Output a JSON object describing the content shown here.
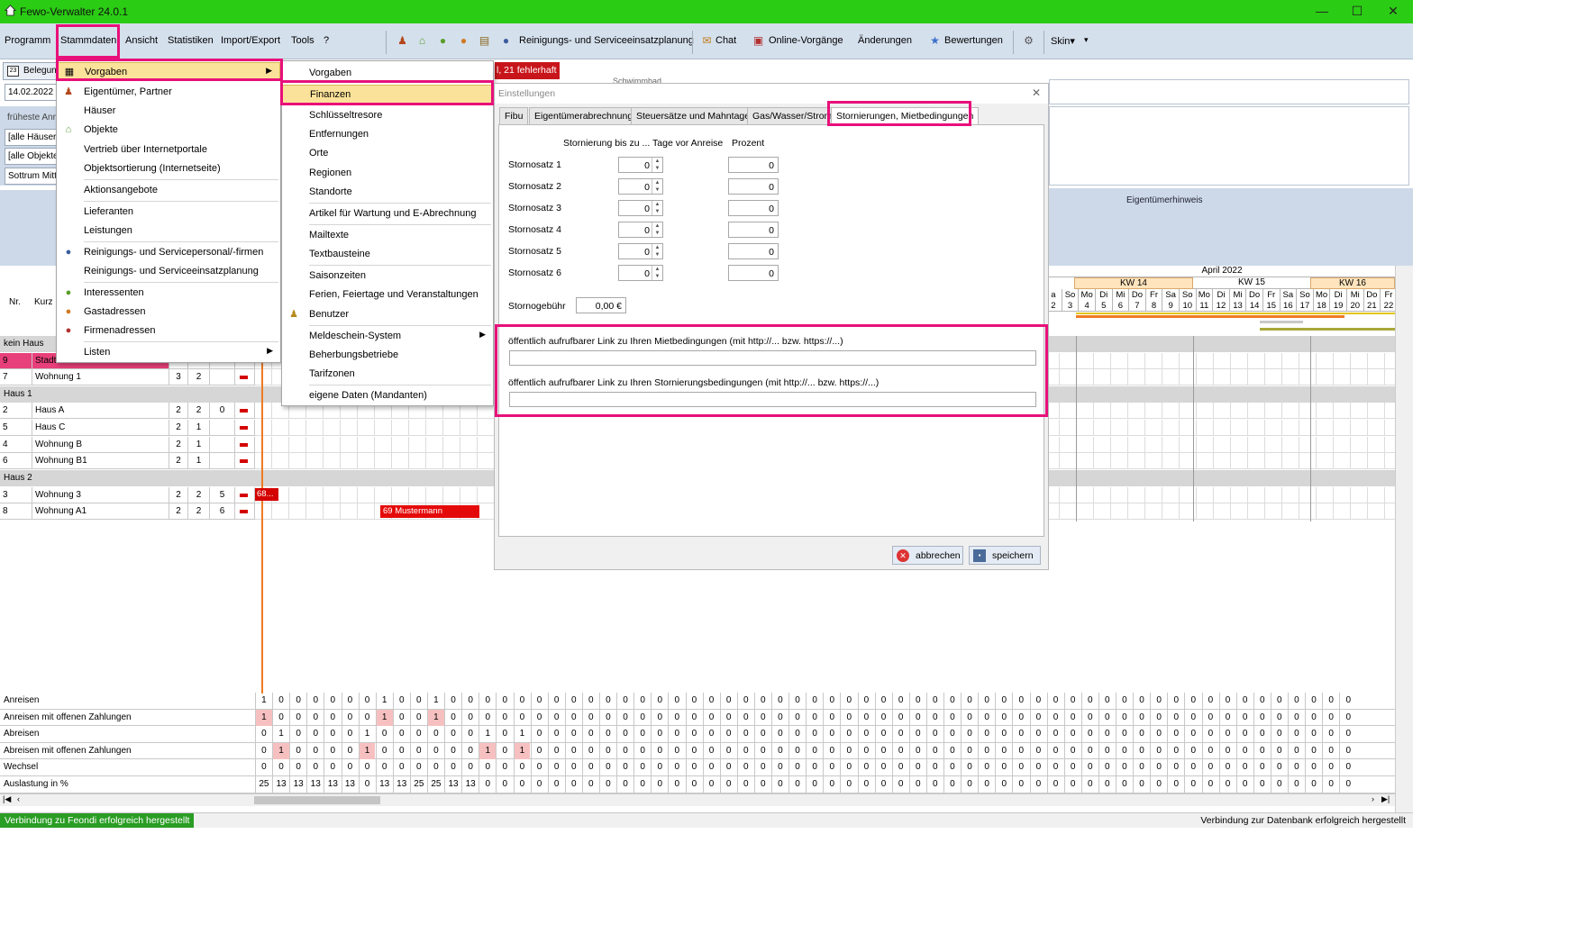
{
  "window": {
    "title": "Fewo-Verwalter 24.0.1",
    "minimize": "—",
    "maximize": "☐",
    "close": "✕"
  },
  "menubar": {
    "items": [
      "Programm",
      "Stammdaten",
      "Ansicht",
      "Statistiken",
      "Import/Export",
      "Tools",
      "?"
    ],
    "toolbar": {
      "cleaning_planning": "Reinigungs- und Serviceeinsatzplanung",
      "chat": "Chat",
      "online": "Online-Vorgänge",
      "changes": "Änderungen",
      "ratings": "Bewertungen",
      "skin": "Skin▾",
      "overflow": "▾"
    }
  },
  "left": {
    "tab_label": "Belegung",
    "date": "14.02.2022",
    "earliest_label": "früheste Anr",
    "houses": "[alle Häuser]",
    "objects": "[alle Objekte]",
    "location": "Sottrum Mitt",
    "col_nr": "Nr.",
    "col_kurz": "Kurz"
  },
  "alert": "l, 21 fehlerhaft",
  "top_text": "Schwimmbad",
  "owner_hint": "Eigentümerhinweis",
  "groups": {
    "kein_haus": "kein Haus",
    "haus1": "Haus 1",
    "haus2": "Haus 2"
  },
  "rows": [
    {
      "nr": "9",
      "name": "Stadt",
      "a": "",
      "b": "",
      "c": "",
      "pink": true
    },
    {
      "nr": "7",
      "name": "Wohnung 1",
      "a": "3",
      "b": "2",
      "c": ""
    },
    {
      "nr": "2",
      "name": "Haus A",
      "a": "2",
      "b": "2",
      "c": "0"
    },
    {
      "nr": "5",
      "name": "Haus C",
      "a": "2",
      "b": "1",
      "c": ""
    },
    {
      "nr": "4",
      "name": "Wohnung B",
      "a": "2",
      "b": "1",
      "c": ""
    },
    {
      "nr": "6",
      "name": "Wohnung B1",
      "a": "2",
      "b": "1",
      "c": ""
    },
    {
      "nr": "3",
      "name": "Wohnung 3",
      "a": "2",
      "b": "2",
      "c": "5"
    },
    {
      "nr": "8",
      "name": "Wohnung A1",
      "a": "2",
      "b": "2",
      "c": "6"
    }
  ],
  "bookings": {
    "b1": "68...",
    "b2": "69 Mustermann"
  },
  "menu_stammdaten": {
    "vorgaben": "Vorgaben",
    "eigentuemer": "Eigentümer, Partner",
    "haeuser": "Häuser",
    "objekte": "Objekte",
    "vertrieb": "Vertrieb über Internetportale",
    "sortierung": "Objektsortierung (Internetseite)",
    "aktion": "Aktionsangebote",
    "lieferanten": "Lieferanten",
    "leistungen": "Leistungen",
    "personal": "Reinigungs- und Servicepersonal/-firmen",
    "einsatz": "Reinigungs- und Serviceeinsatzplanung",
    "interessenten": "Interessenten",
    "gast": "Gastadressen",
    "firmen": "Firmenadressen",
    "listen": "Listen"
  },
  "menu_vorgaben": {
    "vorgaben": "Vorgaben",
    "finanzen": "Finanzen",
    "schluessel": "Schlüsseltresore",
    "entfernungen": "Entfernungen",
    "orte": "Orte",
    "regionen": "Regionen",
    "standorte": "Standorte",
    "artikel": "Artikel für Wartung und E-Abrechnung",
    "mailtexte": "Mailtexte",
    "textbausteine": "Textbausteine",
    "saison": "Saisonzeiten",
    "ferien": "Ferien, Feiertage und Veranstaltungen",
    "benutzer": "Benutzer",
    "meldeschein": "Meldeschein-System",
    "beherbergung": "Beherbungsbetriebe",
    "tarif": "Tarifzonen",
    "eigene": "eigene Daten (Mandanten)"
  },
  "dialog": {
    "title": "Einstellungen",
    "close": "✕",
    "tabs": [
      "Fibu",
      "Eigentümerabrechnung",
      "Steuersätze und Mahntage",
      "Gas/Wasser/Strom",
      "Stornierungen, Mietbedingungen"
    ],
    "col_days": "Stornierung bis zu ... Tage vor Anreise",
    "col_percent": "Prozent",
    "rates": [
      {
        "label": "Stornosatz 1",
        "days": "0",
        "percent": "0"
      },
      {
        "label": "Stornosatz 2",
        "days": "0",
        "percent": "0"
      },
      {
        "label": "Stornosatz 3",
        "days": "0",
        "percent": "0"
      },
      {
        "label": "Stornosatz 4",
        "days": "0",
        "percent": "0"
      },
      {
        "label": "Stornosatz 5",
        "days": "0",
        "percent": "0"
      },
      {
        "label": "Stornosatz 6",
        "days": "0",
        "percent": "0"
      }
    ],
    "fee_label": "Stornogebühr",
    "fee_value": "0,00 €",
    "link1_label": "öffentlich aufrufbarer Link zu Ihren Mietbedingungen (mit http://... bzw. https://...)",
    "link1_value": "",
    "link2_label": "öffentlich aufrufbarer Link zu Ihren Stornierungsbedingungen (mit http://... bzw. https://...)",
    "link2_value": "",
    "cancel": "abbrechen",
    "save": "speichern"
  },
  "calendar": {
    "month": "April 2022",
    "kw14": "KW 14",
    "kw15": "KW 15",
    "kw16": "KW 16",
    "days": [
      [
        "a",
        "2"
      ],
      [
        "So",
        "3"
      ],
      [
        "Mo",
        "4"
      ],
      [
        "Di",
        "5"
      ],
      [
        "Mi",
        "6"
      ],
      [
        "Do",
        "7"
      ],
      [
        "Fr",
        "8"
      ],
      [
        "Sa",
        "9"
      ],
      [
        "So",
        "10"
      ],
      [
        "Mo",
        "11"
      ],
      [
        "Di",
        "12"
      ],
      [
        "Mi",
        "13"
      ],
      [
        "Do",
        "14"
      ],
      [
        "Fr",
        "15"
      ],
      [
        "Sa",
        "16"
      ],
      [
        "So",
        "17"
      ],
      [
        "Mo",
        "18"
      ],
      [
        "Di",
        "19"
      ],
      [
        "Mi",
        "20"
      ],
      [
        "Do",
        "21"
      ],
      [
        "Fr",
        "22"
      ]
    ]
  },
  "stats": {
    "labels": [
      "Anreisen",
      "Anreisen mit offenen Zahlungen",
      "Abreisen",
      "Abreisen mit offenen Zahlungen",
      "Wechsel",
      "Auslastung in %"
    ],
    "values": [
      [
        "1",
        "0",
        "0",
        "0",
        "0",
        "0",
        "0",
        "1",
        "0",
        "0",
        "1",
        "0",
        "0",
        "0",
        "0",
        "0",
        "0",
        "0",
        "0",
        "0",
        "0",
        "0",
        "0",
        "0",
        "0",
        "0",
        "0",
        "0",
        "0",
        "0",
        "0",
        "0",
        "0",
        "0",
        "0",
        "0",
        "0",
        "0",
        "0",
        "0",
        "0",
        "0",
        "0",
        "0",
        "0",
        "0",
        "0",
        "0",
        "0",
        "0",
        "0",
        "0",
        "0",
        "0",
        "0",
        "0",
        "0",
        "0",
        "0",
        "0",
        "0",
        "0",
        "0",
        "0"
      ],
      [
        "1",
        "0",
        "0",
        "0",
        "0",
        "0",
        "0",
        "1",
        "0",
        "0",
        "1",
        "0",
        "0",
        "0",
        "0",
        "0",
        "0",
        "0",
        "0",
        "0",
        "0",
        "0",
        "0",
        "0",
        "0",
        "0",
        "0",
        "0",
        "0",
        "0",
        "0",
        "0",
        "0",
        "0",
        "0",
        "0",
        "0",
        "0",
        "0",
        "0",
        "0",
        "0",
        "0",
        "0",
        "0",
        "0",
        "0",
        "0",
        "0",
        "0",
        "0",
        "0",
        "0",
        "0",
        "0",
        "0",
        "0",
        "0",
        "0",
        "0",
        "0",
        "0",
        "0",
        "0"
      ],
      [
        "0",
        "1",
        "0",
        "0",
        "0",
        "0",
        "1",
        "0",
        "0",
        "0",
        "0",
        "0",
        "0",
        "1",
        "0",
        "1",
        "0",
        "0",
        "0",
        "0",
        "0",
        "0",
        "0",
        "0",
        "0",
        "0",
        "0",
        "0",
        "0",
        "0",
        "0",
        "0",
        "0",
        "0",
        "0",
        "0",
        "0",
        "0",
        "0",
        "0",
        "0",
        "0",
        "0",
        "0",
        "0",
        "0",
        "0",
        "0",
        "0",
        "0",
        "0",
        "0",
        "0",
        "0",
        "0",
        "0",
        "0",
        "0",
        "0",
        "0",
        "0",
        "0",
        "0",
        "0"
      ],
      [
        "0",
        "1",
        "0",
        "0",
        "0",
        "0",
        "1",
        "0",
        "0",
        "0",
        "0",
        "0",
        "0",
        "1",
        "0",
        "1",
        "0",
        "0",
        "0",
        "0",
        "0",
        "0",
        "0",
        "0",
        "0",
        "0",
        "0",
        "0",
        "0",
        "0",
        "0",
        "0",
        "0",
        "0",
        "0",
        "0",
        "0",
        "0",
        "0",
        "0",
        "0",
        "0",
        "0",
        "0",
        "0",
        "0",
        "0",
        "0",
        "0",
        "0",
        "0",
        "0",
        "0",
        "0",
        "0",
        "0",
        "0",
        "0",
        "0",
        "0",
        "0",
        "0",
        "0",
        "0"
      ],
      [
        "0",
        "0",
        "0",
        "0",
        "0",
        "0",
        "0",
        "0",
        "0",
        "0",
        "0",
        "0",
        "0",
        "0",
        "0",
        "0",
        "0",
        "0",
        "0",
        "0",
        "0",
        "0",
        "0",
        "0",
        "0",
        "0",
        "0",
        "0",
        "0",
        "0",
        "0",
        "0",
        "0",
        "0",
        "0",
        "0",
        "0",
        "0",
        "0",
        "0",
        "0",
        "0",
        "0",
        "0",
        "0",
        "0",
        "0",
        "0",
        "0",
        "0",
        "0",
        "0",
        "0",
        "0",
        "0",
        "0",
        "0",
        "0",
        "0",
        "0",
        "0",
        "0",
        "0",
        "0"
      ],
      [
        "25",
        "13",
        "13",
        "13",
        "13",
        "13",
        "0",
        "13",
        "13",
        "25",
        "25",
        "13",
        "13",
        "0",
        "0",
        "0",
        "0",
        "0",
        "0",
        "0",
        "0",
        "0",
        "0",
        "0",
        "0",
        "0",
        "0",
        "0",
        "0",
        "0",
        "0",
        "0",
        "0",
        "0",
        "0",
        "0",
        "0",
        "0",
        "0",
        "0",
        "0",
        "0",
        "0",
        "0",
        "0",
        "0",
        "0",
        "0",
        "0",
        "0",
        "0",
        "0",
        "0",
        "0",
        "0",
        "0",
        "0",
        "0",
        "0",
        "0",
        "0",
        "0",
        "0",
        "0"
      ]
    ]
  },
  "status": {
    "left": "Verbindung zu Feondi erfolgreich hergestellt",
    "right": "Verbindung zur Datenbank erfolgreich hergestellt"
  }
}
